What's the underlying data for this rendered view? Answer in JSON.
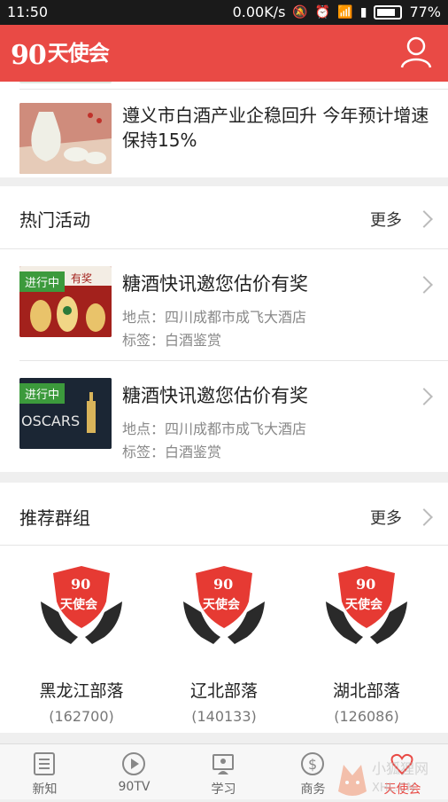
{
  "status_bar": {
    "time": "11:50",
    "speed": "0.00K/s",
    "battery": "77%"
  },
  "app": {
    "logo_num": "90",
    "logo_text": "天使会"
  },
  "news": [
    {
      "title": "遵义市白酒产业企稳回升 今年预计增速保持15%"
    }
  ],
  "hot_events": {
    "title": "热门活动",
    "more": "更多",
    "items": [
      {
        "badge": "进行中",
        "title": "糖酒快讯邀您估价有奖",
        "location": "地点：四川成都市成飞大酒店",
        "tag": "标签：白酒鉴赏",
        "thumb_text": "有奖"
      },
      {
        "badge": "进行中",
        "title": "糖酒快讯邀您估价有奖",
        "location": "地点：四川成都市成飞大酒店",
        "tag": "标签：白酒鉴赏",
        "thumb_text": "OSCARS"
      }
    ]
  },
  "groups": {
    "title": "推荐群组",
    "more": "更多",
    "items": [
      {
        "name": "黑龙江部落",
        "count": "(162700)"
      },
      {
        "name": "辽北部落",
        "count": "(140133)"
      },
      {
        "name": "湖北部落",
        "count": "(126086)"
      }
    ]
  },
  "tabs": [
    {
      "label": "新知",
      "icon": "news-icon"
    },
    {
      "label": "90TV",
      "icon": "play-icon"
    },
    {
      "label": "学习",
      "icon": "study-icon"
    },
    {
      "label": "商务",
      "icon": "dollar-icon"
    },
    {
      "label": "天使会",
      "icon": "angel-icon",
      "active": true
    }
  ],
  "watermark": "小狐狸网 XHL.CN",
  "colors": {
    "brand": "#e94a45",
    "badge": "#3c9a3c"
  }
}
